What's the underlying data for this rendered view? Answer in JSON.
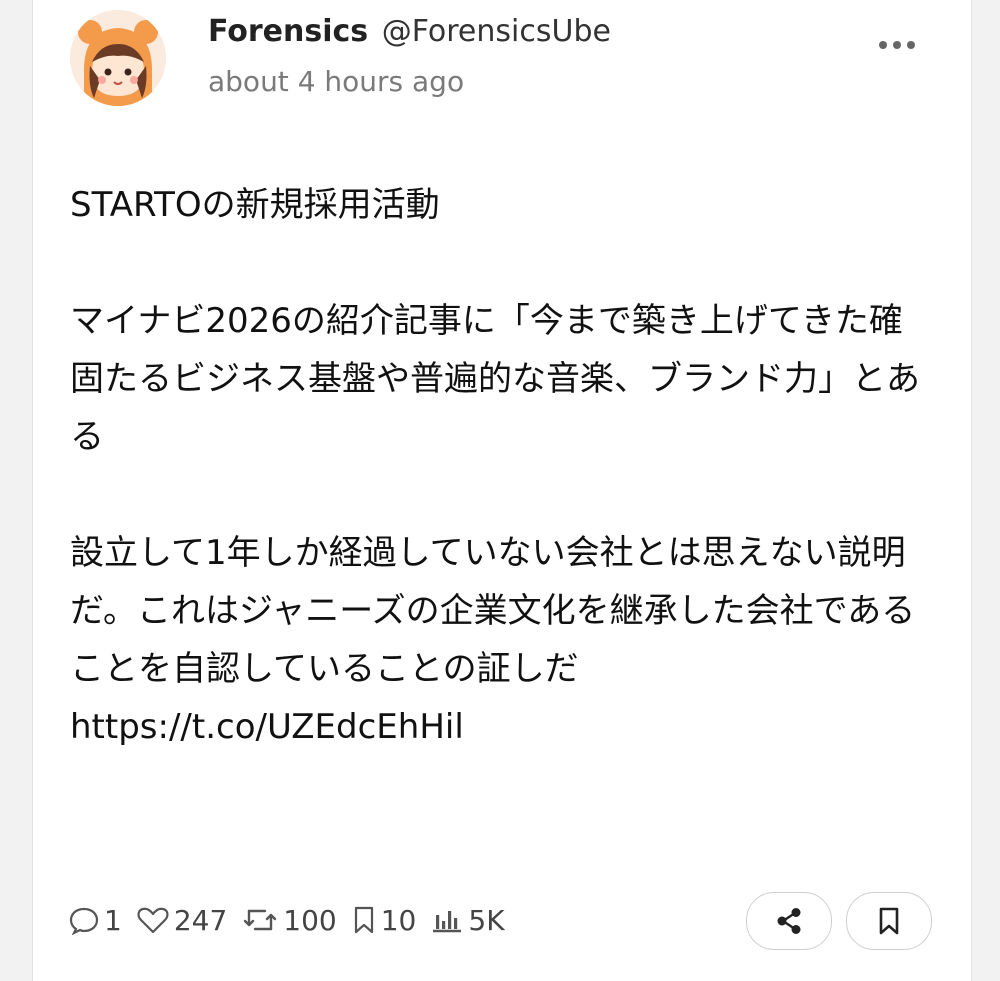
{
  "post": {
    "author_name": "Forensics",
    "author_handle": "@ForensicsUbe",
    "timestamp": "about 4 hours ago",
    "paragraphs": [
      "STARTOの新規採用活動",
      "マイナビ2026の紹介記事に「今まで築き上げてきた確固たるビジネス基盤や普遍的な音楽、ブランド力」とある",
      "設立して1年しか経過していない会社とは思えない説明だ。これはジャニーズの企業文化を継承した会社であることを自認していることの証しだ",
      "https://t.co/UZEdcEhHil"
    ]
  },
  "stats": {
    "replies": "1",
    "likes": "247",
    "reposts": "100",
    "bookmarks": "10",
    "views": "5K"
  },
  "icons": {
    "more": "more-horizontal-icon",
    "reply": "comment-icon",
    "like": "heart-icon",
    "repost": "repost-icon",
    "bookmark": "bookmark-icon",
    "views": "bar-chart-icon",
    "share": "share-icon"
  },
  "colors": {
    "background": "#f2f2f2",
    "card": "#ffffff",
    "text": "#111111",
    "muted": "#7a7a7a",
    "avatar_orange": "#f39a4b"
  }
}
